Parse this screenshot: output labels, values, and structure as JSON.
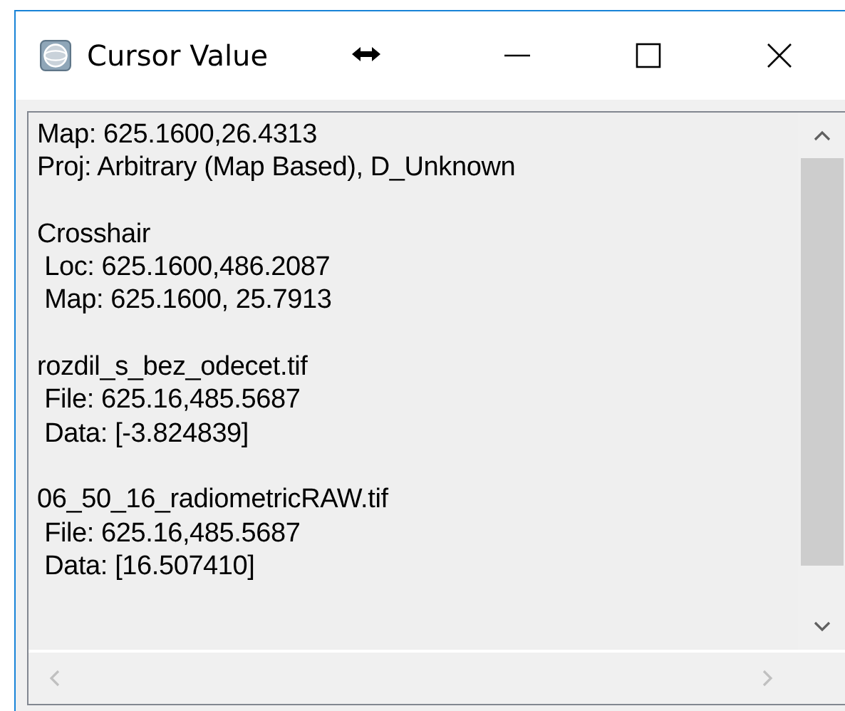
{
  "window": {
    "title": "Cursor Value"
  },
  "sections": [
    {
      "lines": [
        "Map: 625.1600,26.4313",
        "Proj: Arbitrary (Map Based), D_Unknown"
      ]
    },
    {
      "lines": [
        "Crosshair",
        " Loc: 625.1600,486.2087",
        " Map: 625.1600, 25.7913"
      ]
    },
    {
      "lines": [
        "rozdil_s_bez_odecet.tif",
        " File: 625.16,485.5687",
        " Data: [-3.824839]"
      ]
    },
    {
      "lines": [
        "06_50_16_radiometricRAW.tif",
        " File: 625.16,485.5687",
        " Data: [16.507410]"
      ]
    }
  ]
}
